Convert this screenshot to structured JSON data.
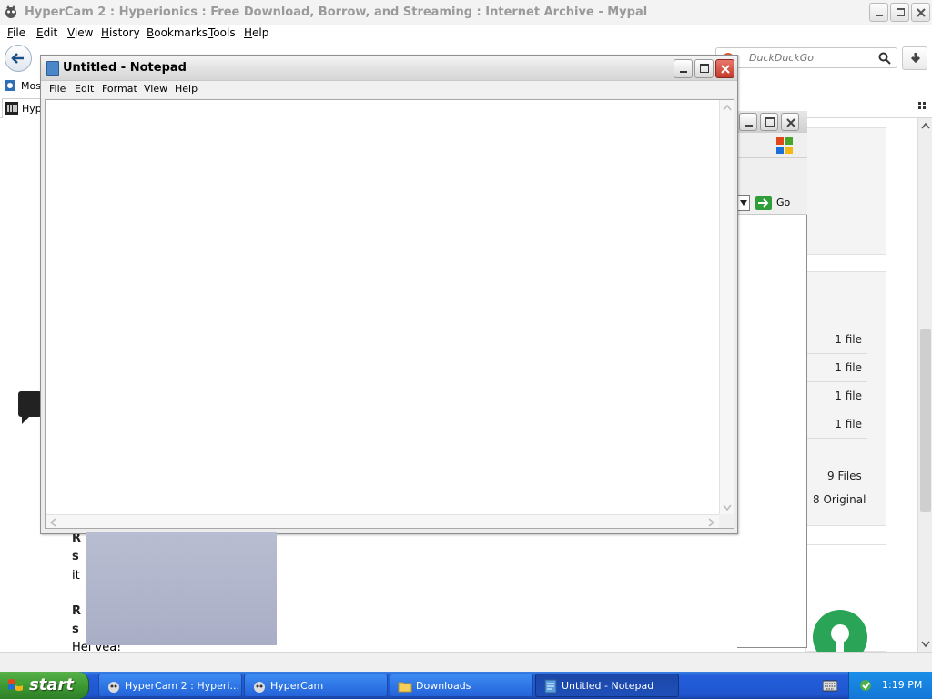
{
  "browser": {
    "title": "HyperCam 2 : Hyperionics : Free Download, Borrow, and Streaming : Internet Archive - Mypal",
    "menu": [
      "File",
      "Edit",
      "View",
      "History",
      "Bookmarks",
      "Tools",
      "Help"
    ],
    "search_placeholder": "DuckDuckGo",
    "bookmark_label": "Most",
    "tab_label": "Hyper"
  },
  "page": {
    "file_rows": [
      "1 file",
      "1 file",
      "1 file",
      "1 file"
    ],
    "total_files": "9 Files",
    "original_count": "8 Original",
    "snippet_letters": [
      "R",
      "s",
      "it",
      "R",
      "s",
      "Hei vea!"
    ]
  },
  "background_window": {
    "go_label": "Go"
  },
  "notepad": {
    "title": "Untitled - Notepad",
    "menu": [
      "File",
      "Edit",
      "Format",
      "View",
      "Help"
    ],
    "content": ""
  },
  "taskbar": {
    "start_label": "start",
    "tasks": [
      {
        "label": "HyperCam 2 : Hyperi...",
        "icon": "hypercam-icon",
        "active": false
      },
      {
        "label": "HyperCam",
        "icon": "hypercam-icon",
        "active": false
      },
      {
        "label": "Downloads",
        "icon": "folder-icon",
        "active": false
      },
      {
        "label": "Untitled - Notepad",
        "icon": "notepad-icon",
        "active": true
      }
    ],
    "clock": "1:19 PM"
  }
}
